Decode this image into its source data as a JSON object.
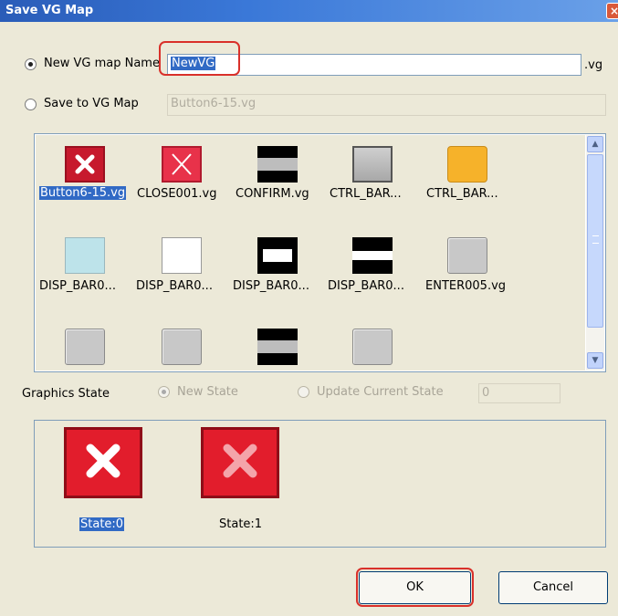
{
  "window": {
    "title": "Save VG Map",
    "close_glyph": "×"
  },
  "name_option": {
    "label": "New VG map Name",
    "value": "NewVG",
    "ext": ".vg",
    "checked": true
  },
  "save_option": {
    "label": "Save to VG Map",
    "value": "Button6-15.vg",
    "checked": false
  },
  "files": [
    {
      "label": "Button6-15.vg",
      "icon": "red-x-icon",
      "selected": true
    },
    {
      "label": "CLOSE001.vg",
      "icon": "red-x-outline-icon",
      "selected": false
    },
    {
      "label": "CONFIRM.vg",
      "icon": "black-bar-button-icon",
      "selected": false
    },
    {
      "label": "CTRL_BAR...",
      "icon": "gray-square-icon",
      "selected": false
    },
    {
      "label": "CTRL_BAR...",
      "icon": "orange-square-icon",
      "selected": false
    },
    {
      "label": "DISP_BAR0...",
      "icon": "cyan-square-icon",
      "selected": false
    },
    {
      "label": "DISP_BAR0...",
      "icon": "white-square-icon",
      "selected": false
    },
    {
      "label": "DISP_BAR0...",
      "icon": "black-white-bar-icon",
      "selected": false
    },
    {
      "label": "DISP_BAR0...",
      "icon": "black-stripe-icon",
      "selected": false
    },
    {
      "label": "ENTER005.vg",
      "icon": "gray-rounded-square-icon",
      "selected": false
    }
  ],
  "graphics_state": {
    "label": "Graphics State",
    "new_state": {
      "label": "New State",
      "checked": true,
      "enabled": false
    },
    "update_state": {
      "label": "Update Current State",
      "checked": false,
      "enabled": false
    },
    "value": "0"
  },
  "states": [
    {
      "label": "State:0",
      "selected": true
    },
    {
      "label": "State:1",
      "selected": false
    }
  ],
  "buttons": {
    "ok": "OK",
    "cancel": "Cancel"
  },
  "colors": {
    "title_bar": "#2a5cb8",
    "highlight": "#d9302a",
    "selection": "#316ac5"
  }
}
